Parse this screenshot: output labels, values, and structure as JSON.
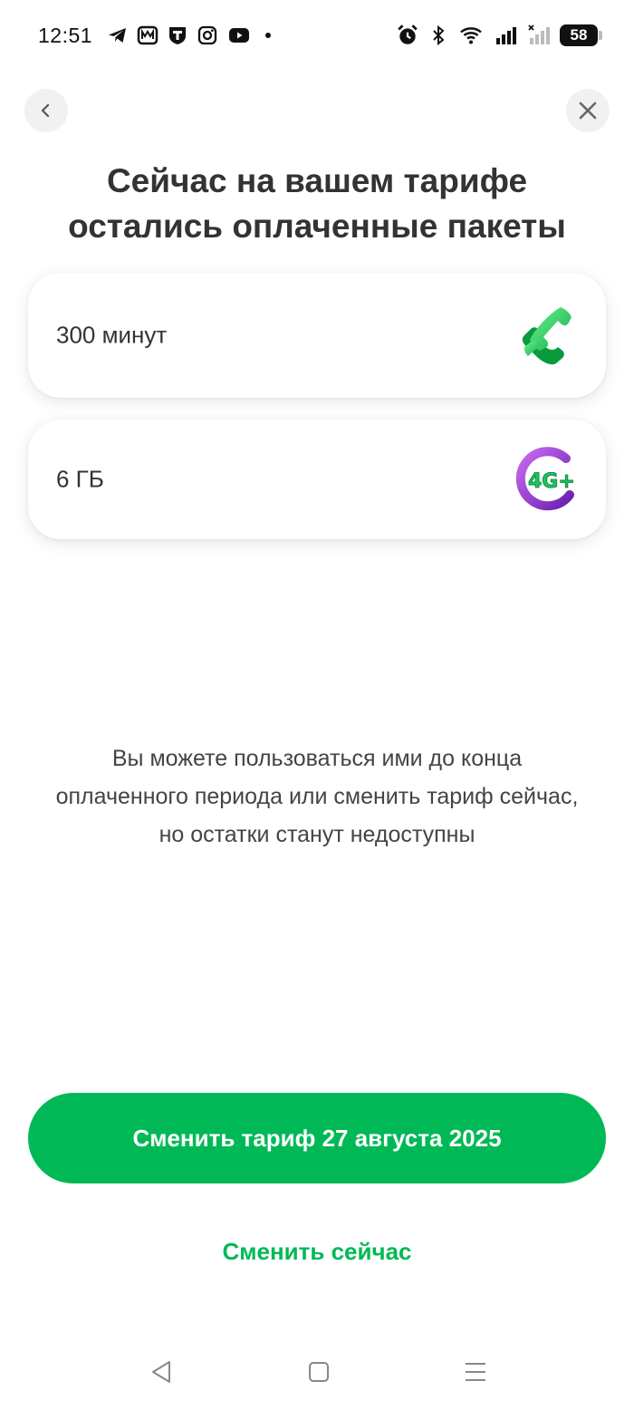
{
  "status_bar": {
    "time": "12:51",
    "battery": "58",
    "left_icons": [
      "telegram-icon",
      "metro-icon",
      "t-bank-icon",
      "instagram-icon",
      "youtube-icon",
      "notification-dot"
    ],
    "right_icons": [
      "alarm-icon",
      "bluetooth-icon",
      "wifi-icon",
      "signal-icon",
      "signal-no-service-icon",
      "battery-icon"
    ]
  },
  "nav": {
    "back_icon": "chevron-left-icon",
    "close_icon": "close-icon"
  },
  "title": {
    "line1": "Сейчас на вашем тарифе",
    "line2": "остались оплаченные пакеты"
  },
  "packages": [
    {
      "label": "300 минут",
      "icon": "phone-icon"
    },
    {
      "label": "6 ГБ",
      "icon": "4g-plus-icon"
    }
  ],
  "description": {
    "line1": "Вы можете пользоваться ими до конца",
    "line2": "оплаченного периода или сменить тариф сейчас,",
    "line3": "но остатки станут недоступны"
  },
  "actions": {
    "primary_label": "Сменить тариф 27 августа 2025",
    "secondary_label": "Сменить сейчас"
  },
  "colors": {
    "accent": "#00b956",
    "text": "#333333",
    "purple": "#8a2be2"
  }
}
